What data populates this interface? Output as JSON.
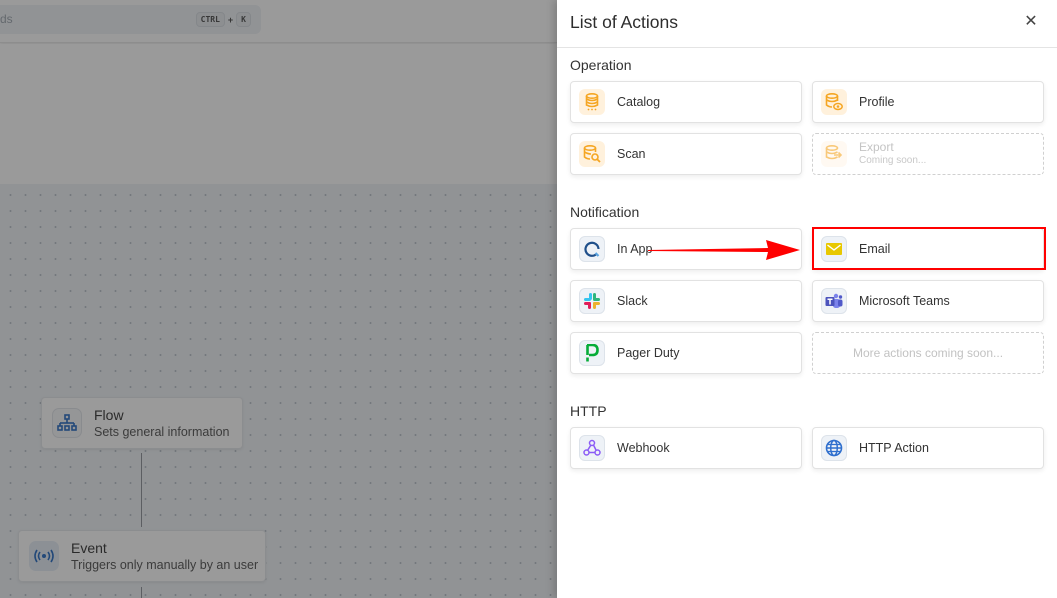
{
  "background_app": {
    "search": {
      "placeholder_fragment": "ds",
      "shortcut_keys": [
        "CTRL",
        "K"
      ],
      "shortcut_separator": "+"
    },
    "nodes": [
      {
        "title": "Flow",
        "subtitle": "Sets general information",
        "icon": "sitemap-icon"
      },
      {
        "title": "Event",
        "subtitle": "Triggers only manually by an user",
        "icon": "broadcast-icon"
      }
    ]
  },
  "drawer": {
    "title": "List of Actions",
    "close_icon": "close-icon",
    "sections": [
      {
        "label": "Operation",
        "items": [
          {
            "label": "Catalog",
            "icon": "database-icon",
            "enabled": true
          },
          {
            "label": "Profile",
            "icon": "database-eye-icon",
            "enabled": true
          },
          {
            "label": "Scan",
            "icon": "database-search-icon",
            "enabled": true
          },
          {
            "label": "Export",
            "sublabel": "Coming soon...",
            "icon": "database-export-icon",
            "enabled": false
          }
        ]
      },
      {
        "label": "Notification",
        "items": [
          {
            "label": "In App",
            "icon": "in-app-notification-icon",
            "enabled": true
          },
          {
            "label": "Email",
            "icon": "email-icon",
            "enabled": true,
            "highlighted": true
          },
          {
            "label": "Slack",
            "icon": "slack-icon",
            "enabled": true
          },
          {
            "label": "Microsoft Teams",
            "icon": "microsoft-teams-icon",
            "enabled": true
          },
          {
            "label": "Pager Duty",
            "icon": "pagerduty-icon",
            "enabled": true
          },
          {
            "label": "More actions coming soon...",
            "enabled": false,
            "placeholder": true
          }
        ]
      },
      {
        "label": "HTTP",
        "items": [
          {
            "label": "Webhook",
            "icon": "webhook-icon",
            "enabled": true
          },
          {
            "label": "HTTP Action",
            "icon": "globe-icon",
            "enabled": true
          }
        ]
      }
    ]
  },
  "annotation": {
    "color": "#ff0000",
    "arrow_from": "In App",
    "arrow_to": "Email"
  },
  "colors": {
    "operation_icon": "#f5a623",
    "operation_icon_bg": "#fff1dc",
    "email_icon": "#e8c800",
    "pagerduty": "#06ac38",
    "teams": "#5059c9",
    "webhook": "#8b5cf6",
    "globe": "#2f6fce",
    "in_app": "#1f4f8a"
  }
}
